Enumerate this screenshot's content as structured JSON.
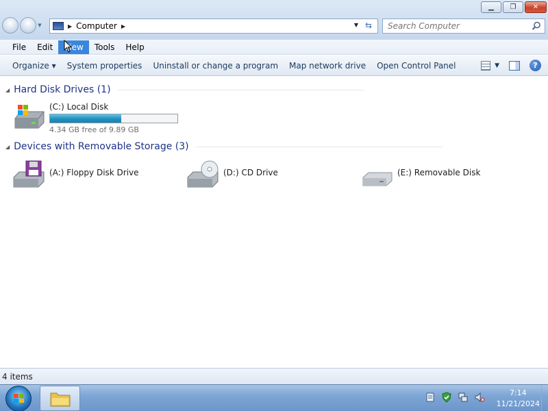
{
  "window": {
    "address_location": "Computer",
    "search_placeholder": "Search Computer"
  },
  "menubar": {
    "items": [
      "File",
      "Edit",
      "View",
      "Tools",
      "Help"
    ],
    "active_index": 2
  },
  "commandbar": {
    "organize": "Organize",
    "system_properties": "System properties",
    "uninstall": "Uninstall or change a program",
    "map_network": "Map network drive",
    "control_panel": "Open Control Panel"
  },
  "groups": {
    "hdd": {
      "title": "Hard Disk Drives (1)",
      "drives": [
        {
          "name": "(C:) Local Disk",
          "free_text": "4.34 GB free of 9.89 GB",
          "used_fraction": 0.56
        }
      ]
    },
    "removable": {
      "title": "Devices with Removable Storage (3)",
      "drives": [
        {
          "name": "(A:) Floppy Disk Drive",
          "icon": "floppy-drive-icon"
        },
        {
          "name": "(D:) CD Drive",
          "icon": "cd-drive-icon"
        },
        {
          "name": "(E:) Removable Disk",
          "icon": "removable-disk-icon"
        }
      ]
    }
  },
  "status": {
    "items_count": "4 items"
  },
  "taskbar": {
    "time": "7:14",
    "date": "11/21/2024"
  },
  "colors": {
    "capacity_fill": "#1e8fbf",
    "active_menu": "#3b86dd",
    "group_title": "#1e3287"
  }
}
